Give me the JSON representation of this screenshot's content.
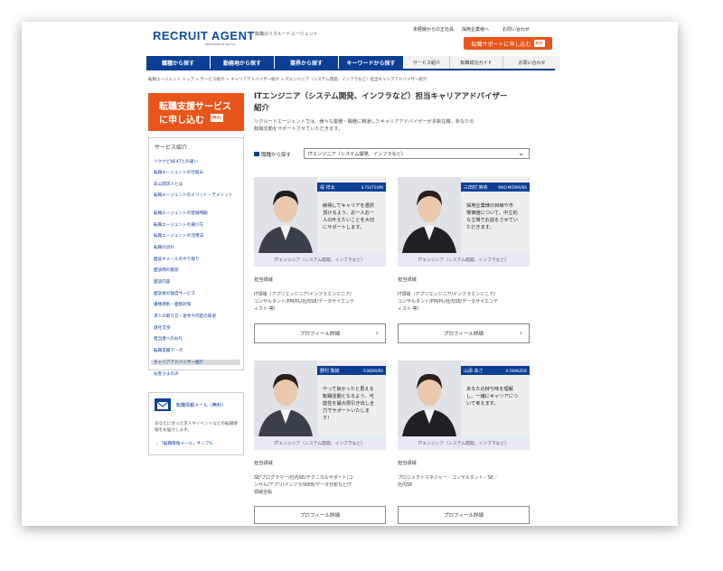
{
  "header": {
    "logo": "RECRUIT AGENT",
    "logo_sub": "PRODUCED BY Recruit",
    "tagline": "転職のリクルートエージェント",
    "links": [
      "未経験からの正社員",
      "採用企業様へ",
      "お問い合わせ"
    ],
    "cta_label": "転職サポートに申し込む",
    "cta_badge": "無料"
  },
  "nav": {
    "main": [
      "職種から探す",
      "勤務地から探す",
      "業界から探す",
      "キーワードから探す"
    ],
    "sub": [
      "サービス紹介",
      "転職成功ガイド",
      "お問い合わせ"
    ]
  },
  "breadcrumb": "転職エージェント トップ > サービス紹介 > キャリアアドバイザー紹介 > ITエンジニア（システム開発、インフラなど）担当キャリアアドバイザー紹介",
  "sidebar": {
    "cta_line1": "転職支援サービス",
    "cta_line2": "に申し込む",
    "cta_badge": "無料",
    "section_title": "サービス紹介",
    "items": [
      "リクナビNEXTとの違い",
      "転職エージェントの仕組み",
      "非公開求人とは",
      "転職エージェントのメリット・デメリット",
      "転職エージェントの登録時期",
      "転職エージェントの選び方",
      "転職エージェントの活用法",
      "転職の流れ",
      "面談やメールのやり取り",
      "面談時の服装",
      "面談内容",
      "面談後の独自サービス",
      "書類添削・面接対策",
      "求人の取り方・退考や内定の辞退",
      "退社交渉",
      "担当者へのお礼",
      "転職実績データ",
      "キャリアアドバイザー紹介",
      "お客さまの声"
    ],
    "active_index": 17,
    "mail_title": "転職情報メール（無料）",
    "mail_desc": "あなたに合った求人やイベントなどの転職情報をお届けします。",
    "mail_link": "「転職情報メール」サンプル"
  },
  "main": {
    "title_line1": "ITエンジニア（システム開発、インフラなど）担当キャリアアドバイザー",
    "title_line2": "紹介",
    "lead_line1": "リクルートエージェントでは、様々な業種・職種に精通したキャリアアドバイザーが多数在籍。あなたの",
    "lead_line2": "転職活動をサポートさせていただきます。",
    "filter_label": "職種から探す",
    "filter_value": "ITエンジニア（システム開発、インフラなど）",
    "domain_label": "担当領域",
    "profile_label": "プロフィール詳細"
  },
  "advisors": [
    {
      "name": "堤 祥太",
      "romaji": "S.TSUTSUMI",
      "quote": [
        "納得してキャリアを選択",
        "頂けるよう、お一人お一",
        "人の叶えたいことを大切",
        "にサポートします。"
      ],
      "category": "ITエンジニア（システム開発、インフラなど）",
      "domain": [
        "IT領域（アプリエンジニア/インフラエンジニア/",
        "コンサルタント/PM/PL/社内SE/データサイエンテ",
        "ィスト 等）"
      ]
    },
    {
      "name": "三田村 麻央",
      "romaji": "MAO.MITAMURA",
      "quote": [
        "採用企業様の目線や市",
        "場価値について、中立的",
        "な立場でお話をさせてい",
        "ただきます。"
      ],
      "category": "ITエンジニア（システム開発、インフラなど）",
      "domain": [
        "IT領域（アプリエンジニア/インフラエンジニア/",
        "コンサルタント/PM/PL/社内SE/データサイエンテ",
        "ィスト 等）"
      ]
    },
    {
      "name": "野村 梨絵",
      "romaji": "R.NOMURA",
      "quote": [
        "やって良かったと思える",
        "転職活動となるよう、可",
        "能性を最大限引き出し全",
        "力でサポートいたしま",
        "す！"
      ],
      "category": "ITエンジニア（システム開発、インフラなど）",
      "domain": [
        "SE/プログラマー/社内SE/テクニカルサポート/コ",
        "ンサル/アプリ/インフラ/WEB/データ分析などIT",
        "領域全般"
      ]
    },
    {
      "name": "山添 あさ",
      "romaji": "A.YAMAZOE",
      "quote": [
        "あなたの持ち味を理解",
        "し、一緒にキャリアにつ",
        "いて考えます。"
      ],
      "category": "ITエンジニア（システム開発、インフラなど）",
      "domain": [
        "プロジェクトマネジャー／コンサルタント／SE／",
        "社内SE"
      ]
    }
  ],
  "colors": {
    "brand_blue": "#0b3f96",
    "accent_orange": "#e8551b"
  }
}
